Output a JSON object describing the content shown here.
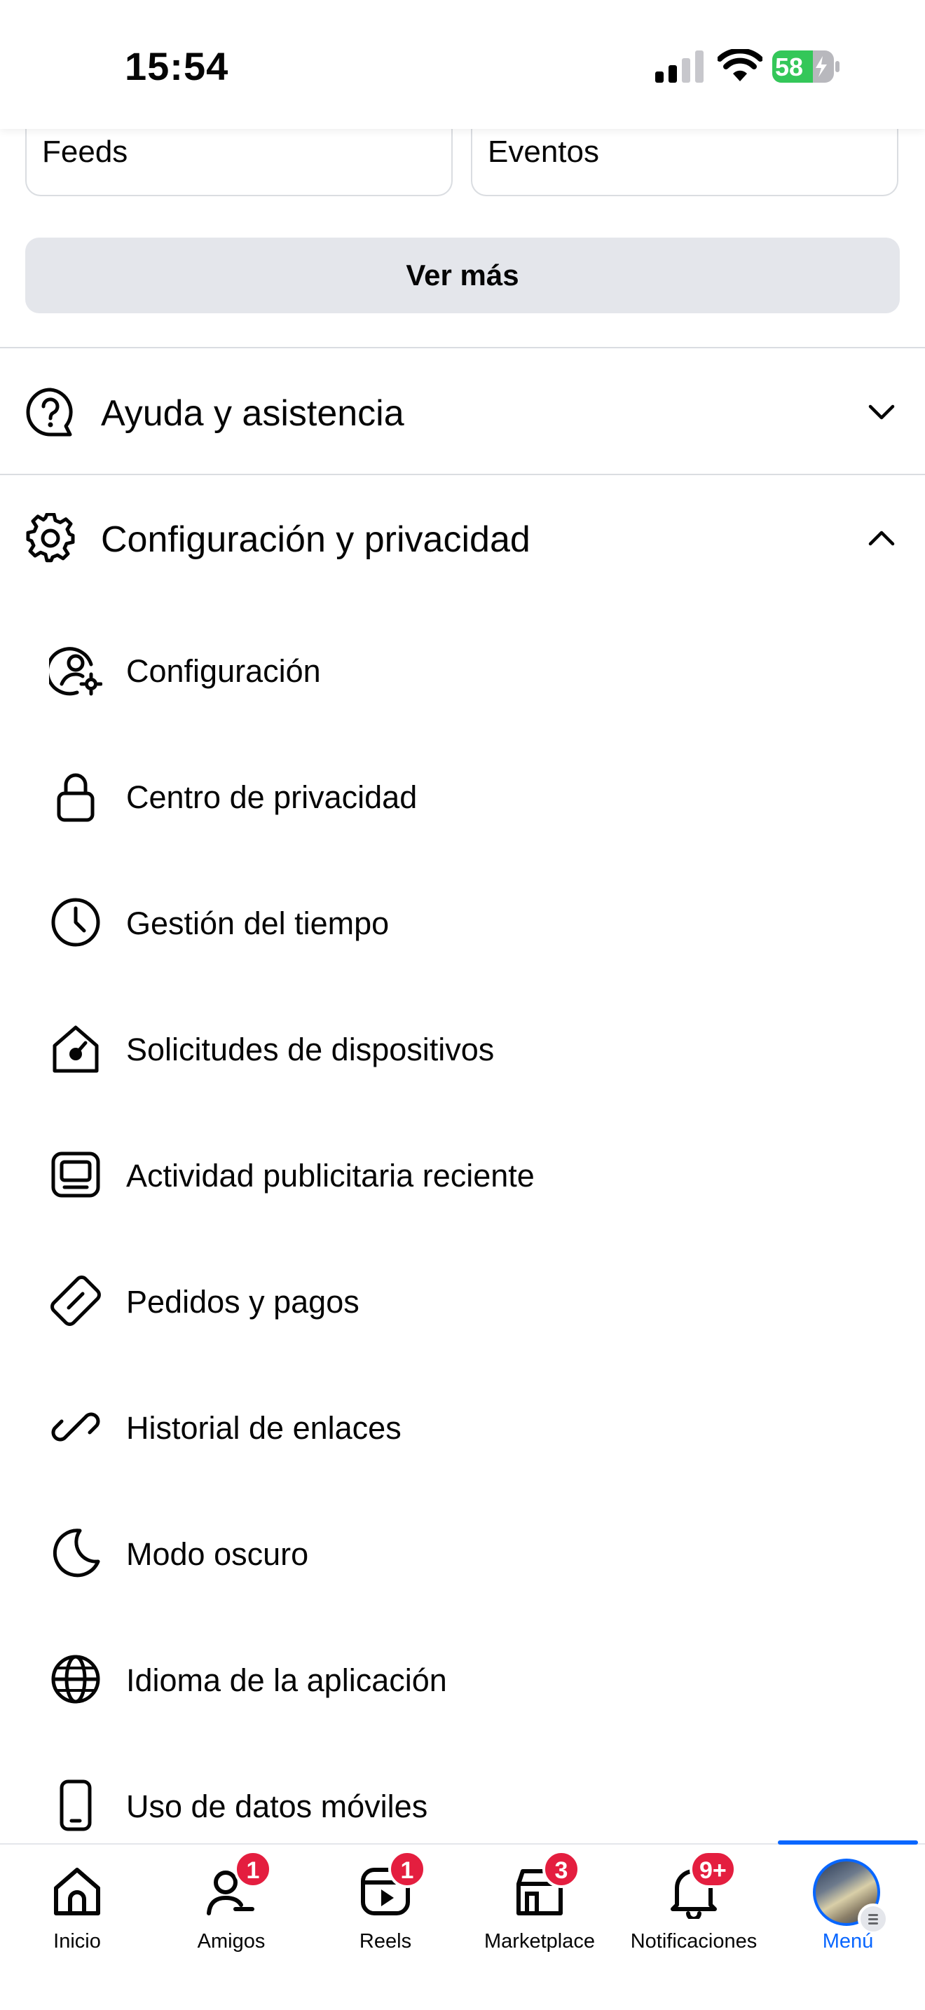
{
  "status_bar": {
    "time": "15:54",
    "battery": "58"
  },
  "shortcuts": [
    {
      "label": "Feeds"
    },
    {
      "label": "Eventos"
    }
  ],
  "see_more_label": "Ver más",
  "sections": {
    "help": {
      "label": "Ayuda y asistencia",
      "icon": "question-bubble-icon",
      "expanded": false
    },
    "settings": {
      "label": "Configuración y privacidad",
      "icon": "gear-icon",
      "expanded": true
    }
  },
  "settings_items": [
    {
      "label": "Configuración",
      "icon": "user-gear-icon"
    },
    {
      "label": "Centro de privacidad",
      "icon": "lock-icon"
    },
    {
      "label": "Gestión del tiempo",
      "icon": "clock-icon"
    },
    {
      "label": "Solicitudes de dispositivos",
      "icon": "home-device-icon"
    },
    {
      "label": "Actividad publicitaria reciente",
      "icon": "monitor-icon"
    },
    {
      "label": "Pedidos y pagos",
      "icon": "card-icon"
    },
    {
      "label": "Historial de enlaces",
      "icon": "link-icon"
    },
    {
      "label": "Modo oscuro",
      "icon": "moon-icon"
    },
    {
      "label": "Idioma de la aplicación",
      "icon": "globe-icon"
    },
    {
      "label": "Uso de datos móviles",
      "icon": "phone-icon"
    }
  ],
  "bottom_nav": [
    {
      "label": "Inicio",
      "icon": "home-icon",
      "badge": ""
    },
    {
      "label": "Amigos",
      "icon": "friends-icon",
      "badge": "1"
    },
    {
      "label": "Reels",
      "icon": "reels-icon",
      "badge": "1"
    },
    {
      "label": "Marketplace",
      "icon": "marketplace-icon",
      "badge": "3"
    },
    {
      "label": "Notificaciones",
      "icon": "bell-icon",
      "badge": "9+"
    },
    {
      "label": "Menú",
      "icon": "avatar-menu-icon",
      "badge": "",
      "active": true
    }
  ],
  "colors": {
    "accent": "#0866ff",
    "badge": "#e41e3f",
    "battery": "#34c759"
  }
}
